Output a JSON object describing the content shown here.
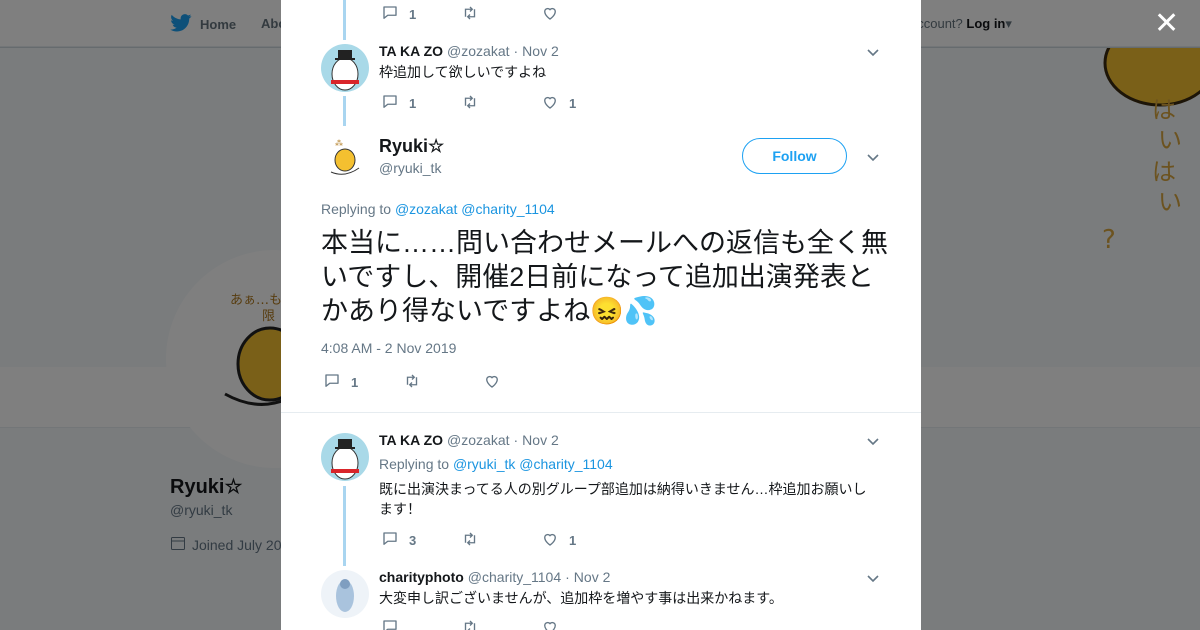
{
  "nav": {
    "home_label": "Home",
    "about_label": "Abo",
    "account_prompt": "account?",
    "login_label": "Log in"
  },
  "profile": {
    "name": "Ryuki☆",
    "handle": "@ryuki_tk",
    "joined": "Joined July 20"
  },
  "colors": {
    "accent": "#1da1f2",
    "link": "#1b95e0",
    "thread": "#a9d5f0",
    "muted": "#657786"
  },
  "tweets": [
    {
      "actions": {
        "reply": "1",
        "retweet": "",
        "like": ""
      }
    },
    {
      "name": "TA KA ZO",
      "handle": "@zozakat",
      "sep": "·",
      "date": "Nov 2",
      "text": "枠追加して欲しいですよね",
      "actions": {
        "reply": "1",
        "retweet": "",
        "like": "1"
      }
    }
  ],
  "main_tweet": {
    "name": "Ryuki☆",
    "handle": "@ryuki_tk",
    "follow_label": "Follow",
    "replying_label": "Replying to",
    "reply_mentions": [
      "@zozakat",
      "@charity_1104"
    ],
    "text": "本当に……問い合わせメールへの返信も全く無いですし、開催2日前になって追加出演発表とかあり得ないですよね😖💦",
    "timestamp": "4:08 AM - 2 Nov 2019",
    "actions": {
      "reply": "1",
      "retweet": "",
      "like": ""
    }
  },
  "replies": [
    {
      "name": "TA KA ZO",
      "handle": "@zozakat",
      "sep": "·",
      "date": "Nov 2",
      "replying_label": "Replying to",
      "mentions": [
        "@ryuki_tk",
        "@charity_1104"
      ],
      "text": "既に出演決まってる人の別グループ部追加は納得いきません…枠追加お願いします！",
      "actions": {
        "reply": "3",
        "retweet": "",
        "like": "1"
      }
    },
    {
      "name": "charityphoto",
      "handle": "@charity_1104",
      "sep": "·",
      "date": "Nov 2",
      "text": "大変申し訳ございませんが、追加枠を増やす事は出来かねます。"
    }
  ],
  "banner_text": "はいはい？",
  "avatar_text": "あぁ…もう限"
}
